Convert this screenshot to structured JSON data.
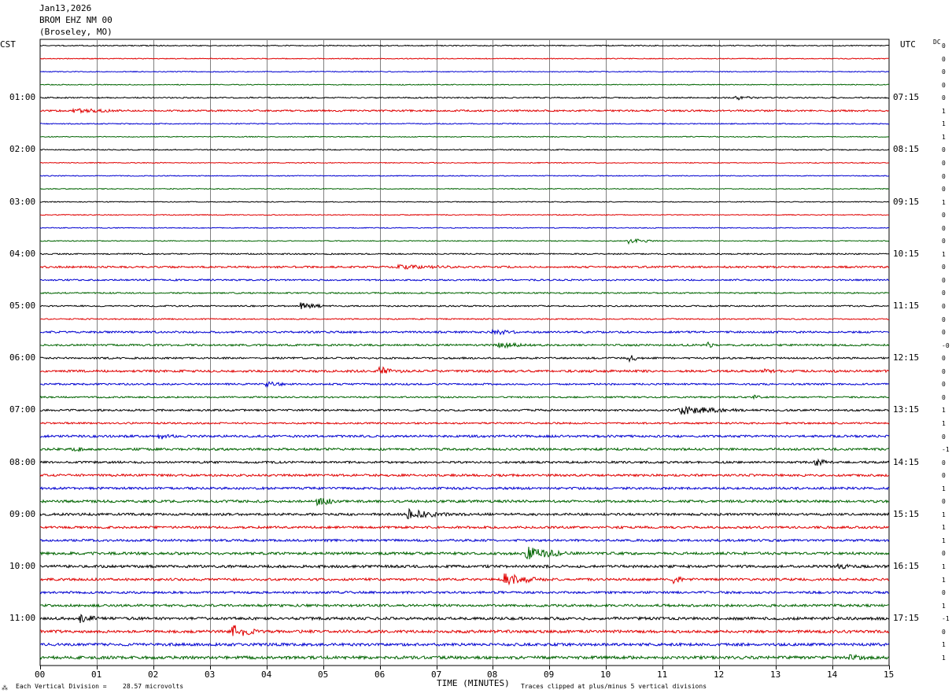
{
  "header": {
    "date": "Jan13,2026",
    "station": "BROM EHZ NM 00",
    "location": "(Broseley, MO)"
  },
  "left_timezone": "CST",
  "right_timezone": "UTC",
  "dc_label": "DC",
  "footer": {
    "scale_prefix": "Each Vertical Division =",
    "scale_value": "28.57 microvolts",
    "clip_note": "Traces clipped at plus/minus 5 vertical divisions",
    "corner_mark": "⁂"
  },
  "colors": {
    "trace_cycle": [
      "#000000",
      "#e00000",
      "#0000d0",
      "#006400"
    ],
    "grid": "#808080"
  },
  "chart_data": {
    "type": "line",
    "title": "",
    "xlabel": "TIME (MINUTES)",
    "ylabel": "",
    "xlim": [
      0,
      15
    ],
    "x_ticks": [
      "00",
      "01",
      "02",
      "03",
      "04",
      "05",
      "06",
      "07",
      "08",
      "09",
      "10",
      "11",
      "12",
      "13",
      "14",
      "15"
    ],
    "trace_count": 48,
    "left_hour_labels": [
      "01:00",
      "02:00",
      "03:00",
      "04:00",
      "05:00",
      "06:00",
      "07:00",
      "08:00",
      "09:00",
      "10:00",
      "11:00"
    ],
    "right_hour_labels": [
      "07:15",
      "08:15",
      "09:15",
      "10:15",
      "11:15",
      "12:15",
      "13:15",
      "14:15",
      "15:15",
      "16:15",
      "17:15"
    ],
    "dc_offsets": [
      "0",
      "0",
      "0",
      "0",
      "0",
      "1",
      "1",
      "1",
      "0",
      "0",
      "0",
      "0",
      "1",
      "0",
      "0",
      "0",
      "1",
      "0",
      "0",
      "0",
      "0",
      "0",
      "0",
      "-0",
      "0",
      "0",
      "0",
      "0",
      "1",
      "1",
      "0",
      "-1",
      "0",
      "0",
      "1",
      "0",
      "1",
      "1",
      "1",
      "0",
      "1",
      "1",
      "0",
      "1",
      "-1",
      "0",
      "1",
      "1"
    ],
    "noise_levels": [
      1.2,
      1.0,
      1.0,
      1.0,
      1.5,
      2.0,
      1.2,
      1.0,
      1.2,
      1.0,
      1.0,
      1.0,
      1.0,
      1.0,
      1.0,
      1.0,
      1.5,
      2.2,
      1.8,
      1.6,
      1.6,
      1.4,
      2.2,
      2.2,
      2.0,
      2.6,
      2.0,
      1.8,
      2.2,
      2.0,
      2.6,
      2.6,
      2.4,
      2.6,
      2.6,
      2.8,
      2.8,
      2.6,
      2.6,
      3.0,
      3.0,
      2.8,
      2.6,
      2.8,
      3.2,
      3.2,
      3.2,
      3.4
    ],
    "events": [
      {
        "trace": 4,
        "minute": 12.3,
        "amplitude": 3,
        "duration": 0.8
      },
      {
        "trace": 5,
        "minute": 0.6,
        "amplitude": 3,
        "duration": 2.5
      },
      {
        "trace": 15,
        "minute": 10.4,
        "amplitude": 4,
        "duration": 0.8
      },
      {
        "trace": 17,
        "minute": 6.3,
        "amplitude": 3,
        "duration": 3.0
      },
      {
        "trace": 20,
        "minute": 4.6,
        "amplitude": 5,
        "duration": 0.8
      },
      {
        "trace": 22,
        "minute": 8.0,
        "amplitude": 4,
        "duration": 1.0
      },
      {
        "trace": 23,
        "minute": 8.1,
        "amplitude": 4,
        "duration": 1.2
      },
      {
        "trace": 23,
        "minute": 11.8,
        "amplitude": 4,
        "duration": 0.3
      },
      {
        "trace": 24,
        "minute": 10.4,
        "amplitude": 5,
        "duration": 0.4
      },
      {
        "trace": 25,
        "minute": 6.0,
        "amplitude": 6,
        "duration": 0.8
      },
      {
        "trace": 25,
        "minute": 12.8,
        "amplitude": 4,
        "duration": 0.5
      },
      {
        "trace": 26,
        "minute": 4.0,
        "amplitude": 4,
        "duration": 0.8
      },
      {
        "trace": 27,
        "minute": 12.6,
        "amplitude": 3,
        "duration": 0.4
      },
      {
        "trace": 28,
        "minute": 11.3,
        "amplitude": 6,
        "duration": 1.8
      },
      {
        "trace": 30,
        "minute": 2.1,
        "amplitude": 5,
        "duration": 0.6
      },
      {
        "trace": 31,
        "minute": 0.6,
        "amplitude": 5,
        "duration": 0.4
      },
      {
        "trace": 32,
        "minute": 13.7,
        "amplitude": 5,
        "duration": 0.6
      },
      {
        "trace": 35,
        "minute": 4.9,
        "amplitude": 6,
        "duration": 0.8
      },
      {
        "trace": 36,
        "minute": 6.5,
        "amplitude": 7,
        "duration": 1.2
      },
      {
        "trace": 39,
        "minute": 8.6,
        "amplitude": 9,
        "duration": 1.2
      },
      {
        "trace": 40,
        "minute": 14.1,
        "amplitude": 4,
        "duration": 0.8
      },
      {
        "trace": 41,
        "minute": 8.2,
        "amplitude": 8,
        "duration": 1.2
      },
      {
        "trace": 41,
        "minute": 11.2,
        "amplitude": 7,
        "duration": 0.3
      },
      {
        "trace": 44,
        "minute": 0.7,
        "amplitude": 6,
        "duration": 0.8
      },
      {
        "trace": 45,
        "minute": 3.4,
        "amplitude": 10,
        "duration": 0.7
      },
      {
        "trace": 47,
        "minute": 14.3,
        "amplitude": 5,
        "duration": 0.8
      }
    ]
  }
}
